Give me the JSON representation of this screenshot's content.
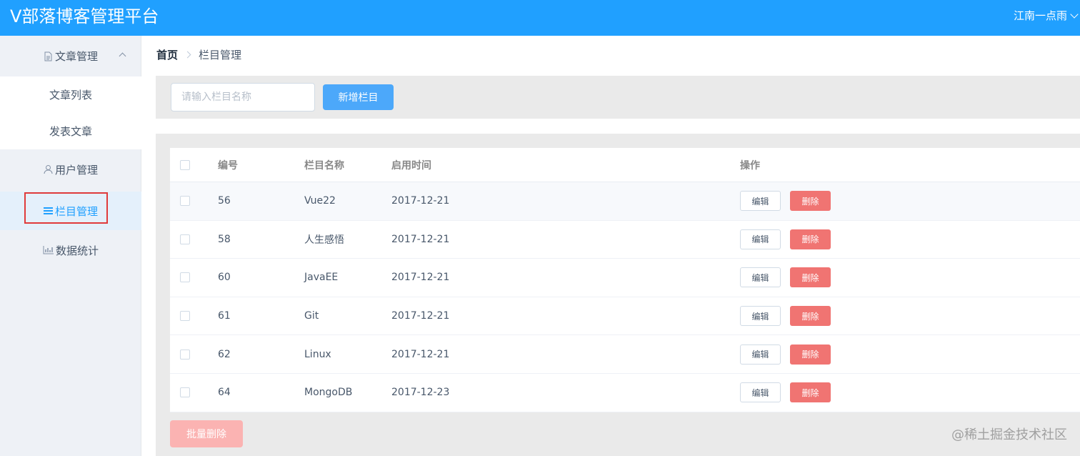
{
  "header": {
    "title": "V部落博客管理平台",
    "user": "江南一点雨"
  },
  "sidebar": {
    "groups": [
      {
        "label": "文章管理",
        "icon": "document-icon",
        "children": [
          "文章列表",
          "发表文章"
        ]
      },
      {
        "label": "用户管理",
        "icon": "user-icon"
      },
      {
        "label": "栏目管理",
        "icon": "list-icon",
        "active": true
      },
      {
        "label": "数据统计",
        "icon": "bar-chart-icon"
      }
    ]
  },
  "breadcrumb": {
    "home": "首页",
    "current": "栏目管理"
  },
  "toolbar": {
    "search_placeholder": "请输入栏目名称",
    "search_value": "",
    "add_label": "新增栏目"
  },
  "table": {
    "headers": {
      "id": "编号",
      "name": "栏目名称",
      "date": "启用时间",
      "ops": "操作"
    },
    "rows": [
      {
        "id": "56",
        "name": "Vue22",
        "date": "2017-12-21"
      },
      {
        "id": "58",
        "name": "人生感悟",
        "date": "2017-12-21"
      },
      {
        "id": "60",
        "name": "JavaEE",
        "date": "2017-12-21"
      },
      {
        "id": "61",
        "name": "Git",
        "date": "2017-12-21"
      },
      {
        "id": "62",
        "name": "Linux",
        "date": "2017-12-21"
      },
      {
        "id": "64",
        "name": "MongoDB",
        "date": "2017-12-23"
      }
    ],
    "edit_label": "编辑",
    "delete_label": "删除"
  },
  "batch_delete_label": "批量删除",
  "watermark": "@稀土掘金技术社区",
  "colors": {
    "header": "#20a0ff",
    "primary_button": "#4ca8fa",
    "danger_button": "#f07472",
    "active_highlight": "#e03b3b"
  }
}
